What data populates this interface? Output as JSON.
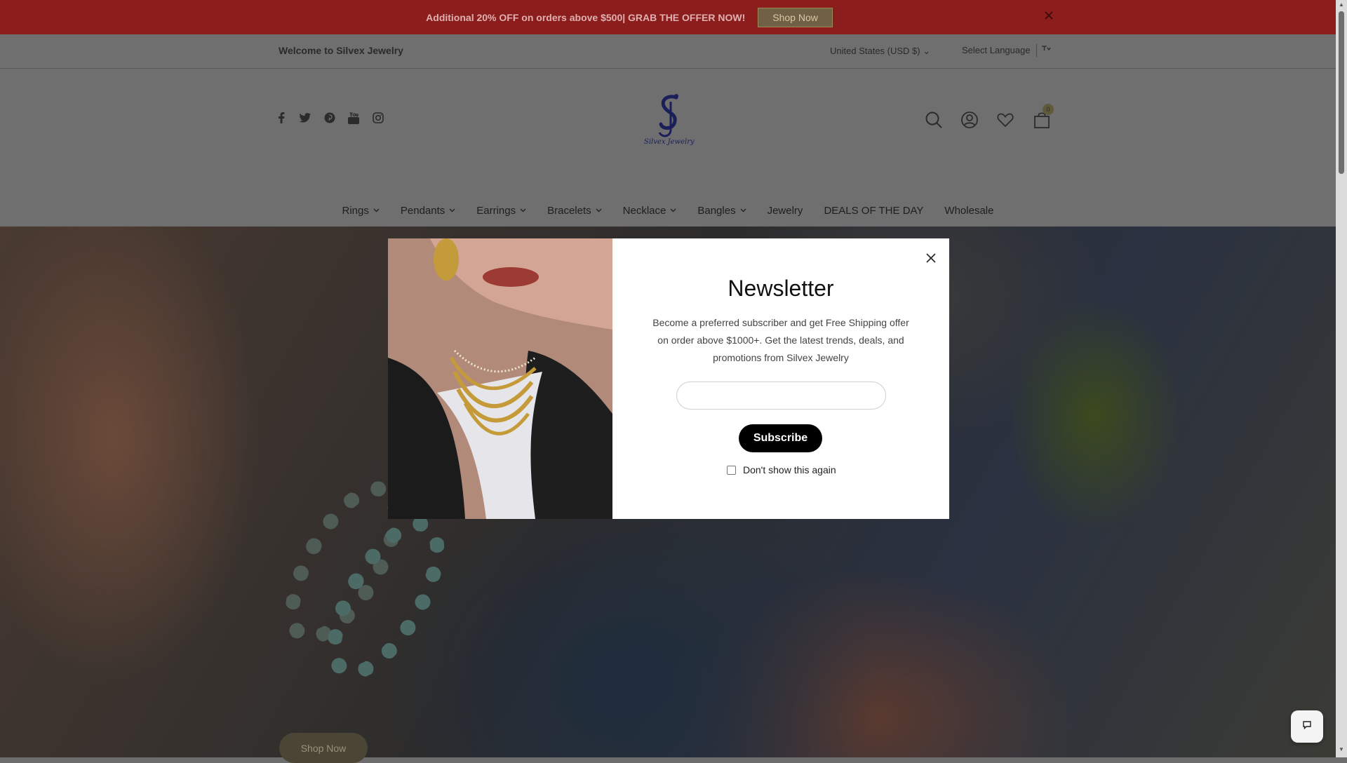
{
  "announcement": {
    "text": "Additional 20% OFF on orders above $500| GRAB THE OFFER NOW!",
    "button_label": "Shop Now"
  },
  "utility_bar": {
    "welcome_text": "Welcome to Silvex Jewelry",
    "currency": "United States (USD $)",
    "language": "Select Language"
  },
  "header": {
    "logo_text": "Silvex Jewelry",
    "social_icons": [
      "facebook-icon",
      "twitter-icon",
      "pinterest-icon",
      "youtube-icon",
      "instagram-icon"
    ],
    "cart_count": "0"
  },
  "nav": {
    "items": [
      {
        "label": "Rings",
        "dropdown": true
      },
      {
        "label": "Pendants",
        "dropdown": true
      },
      {
        "label": "Earrings",
        "dropdown": true
      },
      {
        "label": "Bracelets",
        "dropdown": true
      },
      {
        "label": "Necklace",
        "dropdown": true
      },
      {
        "label": "Bangles",
        "dropdown": true
      },
      {
        "label": "Jewelry",
        "dropdown": false
      },
      {
        "label": "DEALS OF THE DAY",
        "dropdown": false
      },
      {
        "label": "Wholesale",
        "dropdown": false
      }
    ]
  },
  "hero": {
    "button_label": "Shop Now"
  },
  "newsletter": {
    "title": "Newsletter",
    "description": "Become a preferred subscriber and get Free Shipping offer on order above $1000+. Get the latest trends, deals, and promotions from Silvex Jewelry",
    "email_value": "",
    "subscribe_label": "Subscribe",
    "dont_show_label": "Don't show this again",
    "dont_show_checked": false
  },
  "colors": {
    "announcement_bg": "#8b1d1d",
    "modal_bg": "#ffffff",
    "subscribe_bg": "#000000"
  }
}
